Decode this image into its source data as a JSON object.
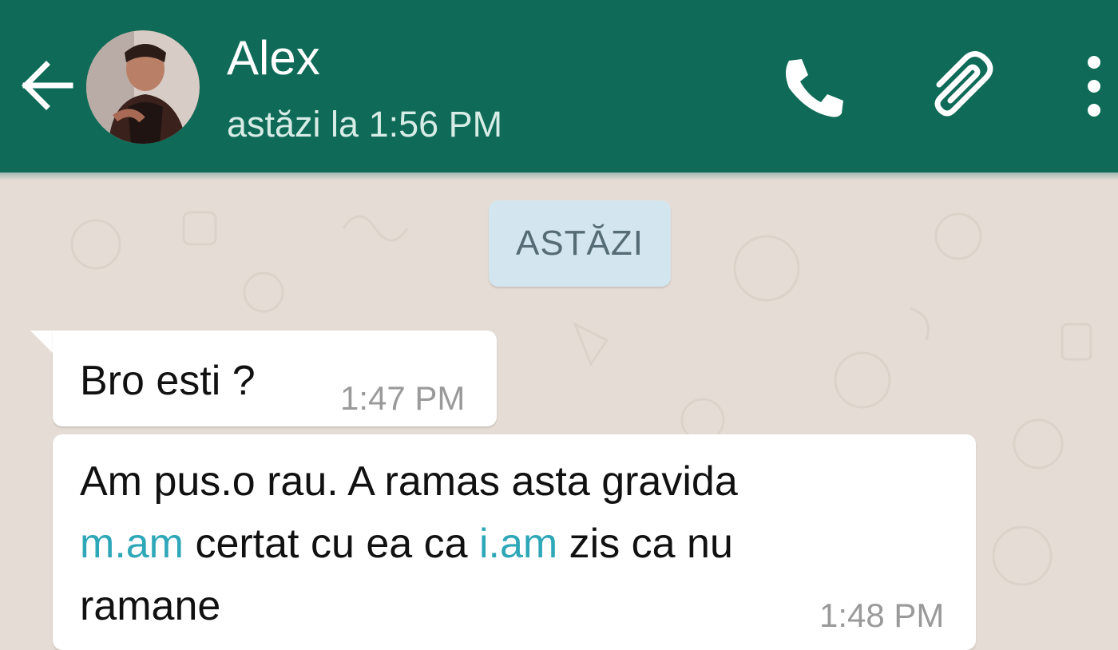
{
  "header": {
    "contact_name": "Alex",
    "last_seen": "astăzi la 1:56 PM",
    "icons": [
      "back-arrow-icon",
      "phone-icon",
      "paperclip-icon",
      "more-vert-icon"
    ],
    "background_color": "#0f6b58"
  },
  "chat": {
    "date_separator": "ASTĂZI",
    "messages": [
      {
        "text": "Bro esti ?",
        "time": "1:47 PM"
      },
      {
        "line1": "Am pus.o rau. A ramas asta gravida",
        "line2_link1": "m.am",
        "line2_mid": " certat cu ea ca ",
        "line2_link2": "i.am",
        "line2_end": " zis ca nu",
        "line3": "ramane",
        "time": "1:48 PM"
      }
    ],
    "link_color": "#2ea7b8"
  }
}
